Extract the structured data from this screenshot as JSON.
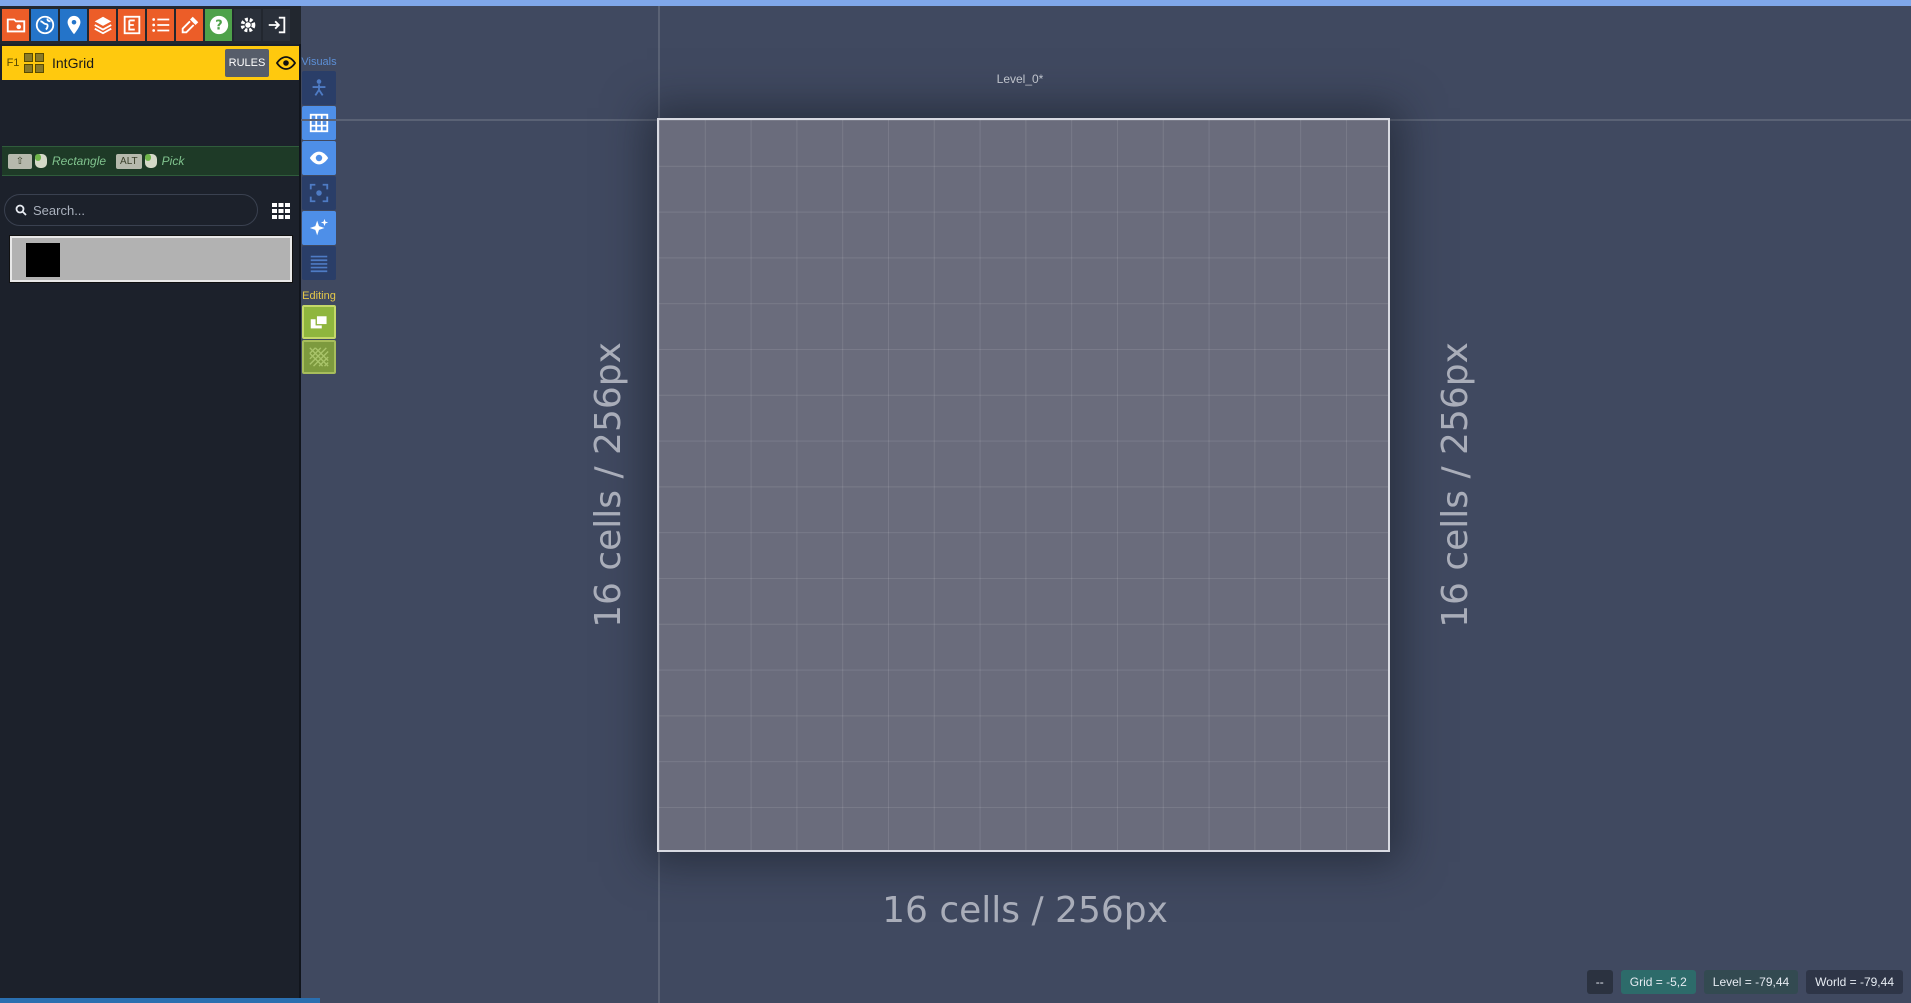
{
  "toolbar": {
    "buttons": [
      {
        "icon": "project-settings-icon",
        "style": "orange"
      },
      {
        "icon": "world-icon",
        "style": "blue"
      },
      {
        "icon": "level-pin-icon",
        "style": "blue"
      },
      {
        "icon": "layers-icon",
        "style": "orange"
      },
      {
        "icon": "entity-icon",
        "style": "orange"
      },
      {
        "icon": "list-icon",
        "style": "orange"
      },
      {
        "icon": "pipette-icon",
        "style": "orange"
      },
      {
        "icon": "help-icon",
        "style": "green"
      },
      {
        "icon": "gear-icon",
        "style": "dark"
      },
      {
        "icon": "exit-icon",
        "style": "dark"
      }
    ]
  },
  "layer": {
    "key": "F1",
    "name": "IntGrid",
    "rules_label": "RULES"
  },
  "shortcuts": {
    "first_key": "⇧",
    "first_label": "Rectangle",
    "second_key": "ALT",
    "second_label": "Pick"
  },
  "search": {
    "placeholder": "Search..."
  },
  "tool_column": {
    "visuals_label": "Visuals",
    "editing_label": "Editing"
  },
  "canvas": {
    "level_name": "Level_0*",
    "dim_bottom": "16 cells / 256px",
    "dim_left": "16 cells / 256px",
    "dim_right": "16 cells / 256px"
  },
  "status": {
    "dash": "--",
    "grid": "Grid = -5,2",
    "level": "Level = -79,44",
    "world": "World = -79,44"
  },
  "colors": {
    "layer_accent": "#ffc90e",
    "toolbar_orange": "#ec5d28",
    "toolbar_blue": "#2474c9",
    "visual_on": "#4e8fe8",
    "editing_green": "#8fb63e"
  }
}
